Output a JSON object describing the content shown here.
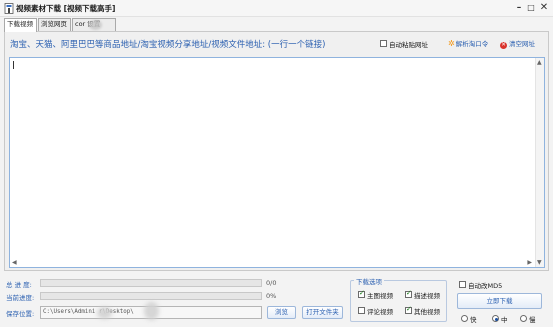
{
  "window": {
    "title": "视频素材下载 [视频下载高手]",
    "min_glyph": "–",
    "max_glyph": "□",
    "close_glyph": "✕"
  },
  "tabs": [
    {
      "label": "下载视频",
      "active": true
    },
    {
      "label": "浏览网页",
      "active": false
    },
    {
      "label": "cor 设置",
      "active": false
    }
  ],
  "panel": {
    "instruction": "淘宝、天猫、阿里巴巴等商品地址/淘宝视频分享地址/视频文件地址: (一行一个链接)",
    "auto_paste_label": "自动粘贴网址",
    "auto_paste_checked": false,
    "parse_label": "解析淘口令",
    "clear_label": "清空网址",
    "url_text": ""
  },
  "progress": {
    "total_label": "总 进 度:",
    "total_value": "0/0",
    "total_fraction": 0,
    "current_label": "当前进度:",
    "current_value": "0%",
    "current_fraction": 0
  },
  "save": {
    "label": "保存位置:",
    "path": "C:\\Users\\Admini    r\\Desktop\\",
    "browse_label": "浏览",
    "open_folder_label": "打开文件夹"
  },
  "download_options": {
    "title": "下载选项",
    "main_video": {
      "label": "主图视频",
      "checked": true
    },
    "desc_video": {
      "label": "描述视频",
      "checked": true
    },
    "review_video": {
      "label": "评论视频",
      "checked": false
    },
    "other_video": {
      "label": "其他视频",
      "checked": true
    }
  },
  "auto_md5": {
    "label": "自动改MD5",
    "checked": false
  },
  "download_button": "立即下载",
  "speed": {
    "fast": {
      "label": "快",
      "checked": false
    },
    "medium": {
      "label": "中",
      "checked": true
    },
    "slow": {
      "label": "慢",
      "checked": false
    }
  },
  "colors": {
    "accent": "#2a5fb0",
    "border_blue": "#8fb3de",
    "clear_icon": "#d9322b",
    "parse_icon": "#f29a1f"
  }
}
